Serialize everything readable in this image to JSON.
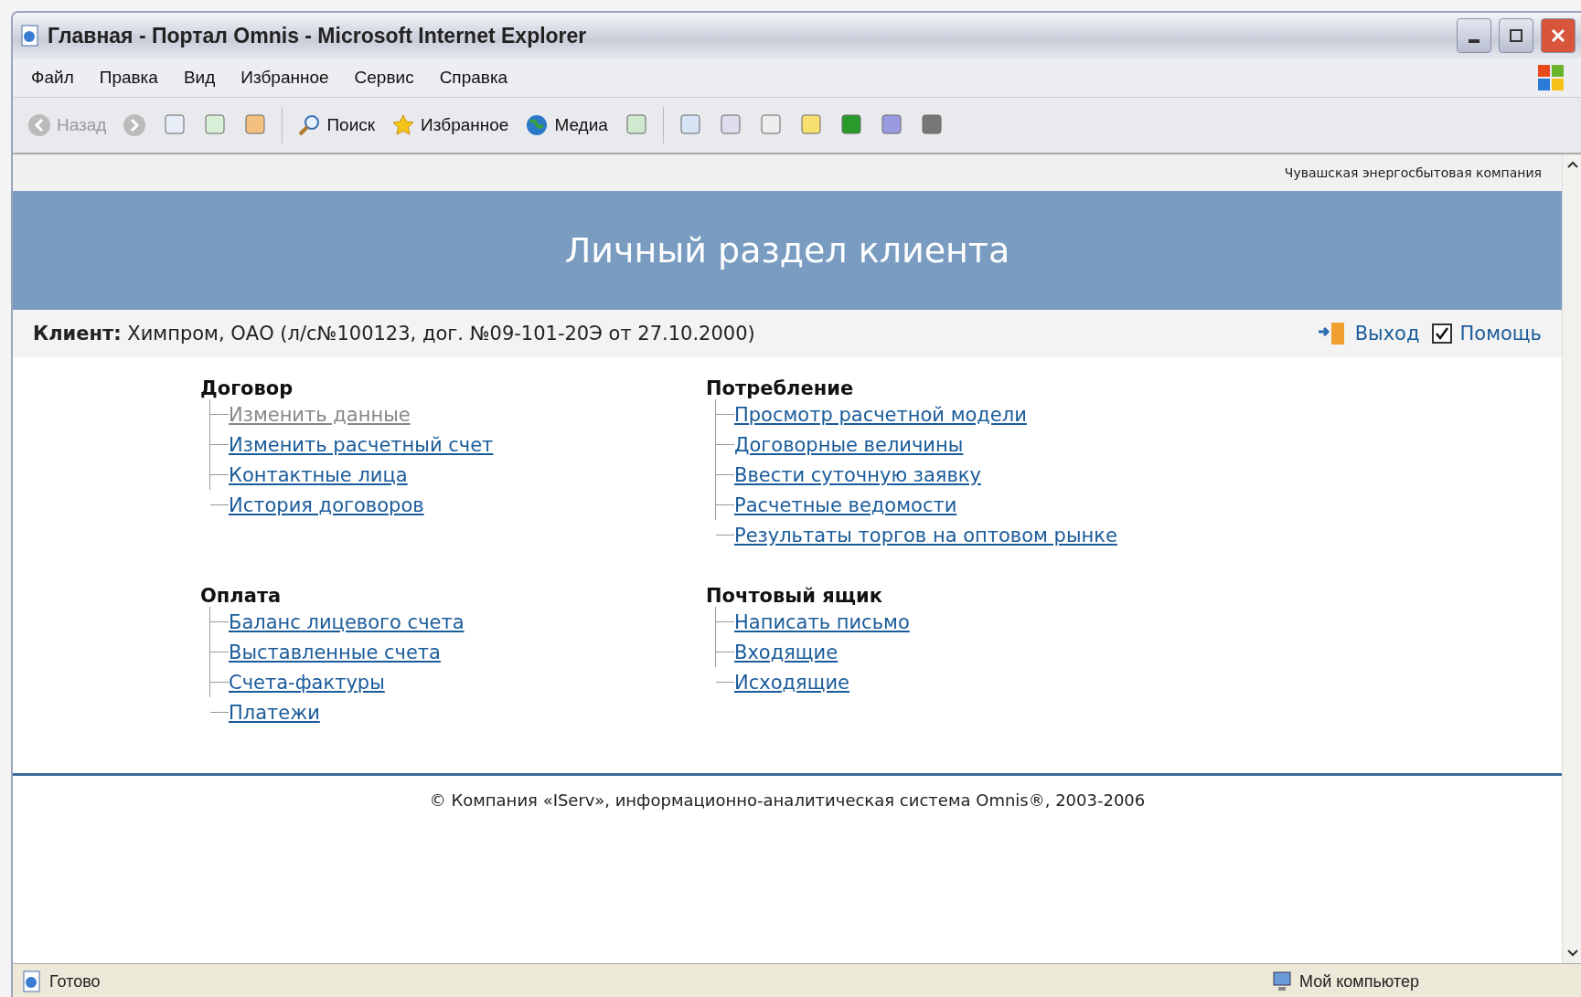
{
  "window": {
    "title": "Главная - Портал Omnis - Microsoft Internet Explorer"
  },
  "menu": [
    "Файл",
    "Правка",
    "Вид",
    "Избранное",
    "Сервис",
    "Справка"
  ],
  "toolbar": [
    {
      "kind": "back",
      "label": "Назад",
      "disabled": true
    },
    {
      "kind": "forward",
      "disabled": true
    },
    {
      "kind": "search",
      "label": "Поиск",
      "disabled": false
    },
    {
      "kind": "favorites",
      "label": "Избранное",
      "disabled": false
    },
    {
      "kind": "media",
      "label": "Медиа",
      "disabled": false
    }
  ],
  "page": {
    "company": "Чувашская энергосбытовая компания",
    "heading": "Личный раздел клиента",
    "client": "**Клиент:** Химпром, ОАО (л/с№100123, дог. №09-101-20Э от 27.10.2000)",
    "logout": "Выход",
    "help": "Помощь",
    "sections": [
      {
        "title": "Договор",
        "links": [
          {
            "label": "Изменить данные",
            "visited": true
          },
          {
            "label": "Изменить расчетный счет",
            "visited": false
          },
          {
            "label": "Контактные лица",
            "visited": false
          },
          {
            "label": "История договоров",
            "visited": false
          }
        ]
      },
      {
        "title": "Потребление",
        "links": [
          {
            "label": "Просмотр расчетной модели",
            "visited": false
          },
          {
            "label": "Договорные величины",
            "visited": false
          },
          {
            "label": "Ввести суточную заявку",
            "visited": false
          },
          {
            "label": "Расчетные ведомости",
            "visited": false
          },
          {
            "label": "Результаты торгов на оптовом рынке",
            "visited": false
          }
        ]
      },
      {
        "title": "Оплата",
        "links": [
          {
            "label": "Баланс лицевого счета",
            "visited": false
          },
          {
            "label": "Выставленные счета",
            "visited": false
          },
          {
            "label": "Счета-фактуры",
            "visited": false
          },
          {
            "label": "Платежи",
            "visited": false
          }
        ]
      },
      {
        "title": "Почтовый ящик",
        "links": [
          {
            "label": "Написать письмо",
            "visited": false
          },
          {
            "label": "Входящие",
            "visited": false
          },
          {
            "label": "Исходящие",
            "visited": false
          }
        ]
      }
    ],
    "footer": "© Компания «IServ», информационно-аналитическая система Omnis®, 2003-2006"
  },
  "status_bar": {
    "text": "Готово",
    "zone": "Мой компьютер"
  }
}
